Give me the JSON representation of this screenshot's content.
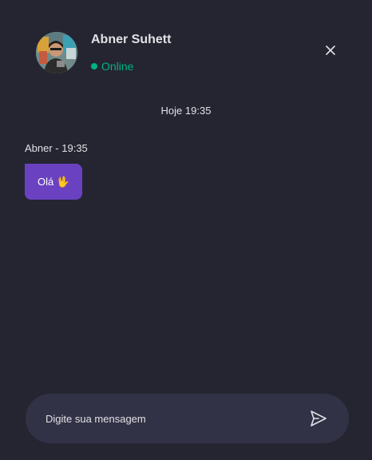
{
  "theme": {
    "background": "#252532",
    "accent": "#7c4dff",
    "bubble": "#6a42c1",
    "online": "#00b37e",
    "composer": "#323246"
  },
  "contact": {
    "name": "Abner Suhett",
    "status": "Online",
    "avatar_icon": "user-avatar-photo"
  },
  "header": {
    "close_icon": "close-icon"
  },
  "conversation": {
    "day_label": "Hoje 19:35",
    "messages": [
      {
        "meta": "Abner - 19:35",
        "text": "Olá 🖖"
      }
    ]
  },
  "composer": {
    "placeholder": "Digite sua mensagem",
    "send_icon": "send-icon"
  }
}
